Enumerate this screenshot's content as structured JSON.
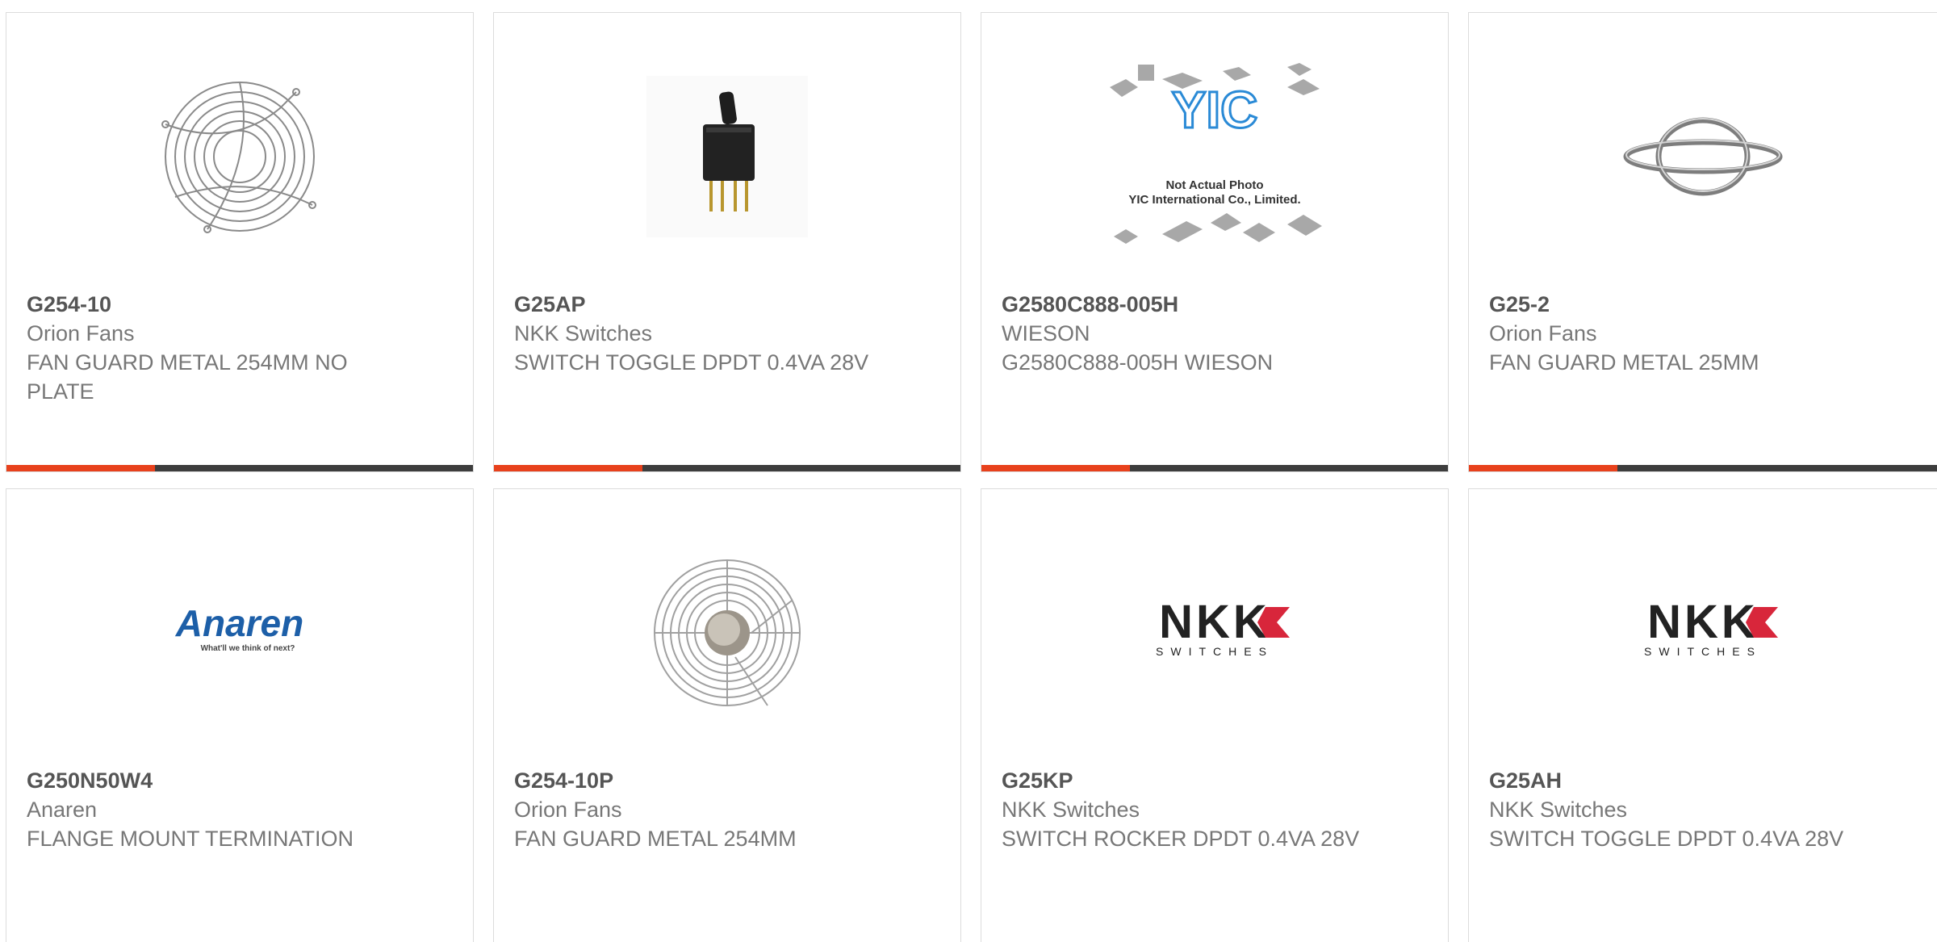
{
  "colors": {
    "accent": "#e8411c",
    "bar": "#3d3d3d",
    "text_title": "#555555",
    "text_body": "#777777",
    "border": "#dcdcdc",
    "nkk_red": "#d8263b",
    "anaren_blue": "#1d5fa8"
  },
  "products": [
    {
      "part": "G254-10",
      "manufacturer": "Orion Fans",
      "description": "FAN GUARD METAL 254MM NO PLATE",
      "image": "fan-guard-spiral-image"
    },
    {
      "part": "G25AP",
      "manufacturer": "NKK Switches",
      "description": "SWITCH TOGGLE DPDT 0.4VA 28V",
      "image": "toggle-switch-image"
    },
    {
      "part": "G2580C888-005H",
      "manufacturer": "WIESON",
      "description": "G2580C888-005H WIESON",
      "image": "yic-placeholder-image",
      "placeholder": {
        "logo": "YIC",
        "line1": "Not Actual Photo",
        "line2": "YIC International Co., Limited."
      }
    },
    {
      "part": "G25-2",
      "manufacturer": "Orion Fans",
      "description": "FAN GUARD METAL 25MM",
      "image": "fan-guard-ring-image"
    },
    {
      "part": "G250N50W4",
      "manufacturer": "Anaren",
      "description": "FLANGE MOUNT TERMINATION",
      "image": "anaren-logo-image",
      "logo": {
        "name": "Anaren",
        "tagline": "What'll we think of next?"
      }
    },
    {
      "part": "G254-10P",
      "manufacturer": "Orion Fans",
      "description": "FAN GUARD METAL 254MM",
      "image": "fan-guard-plate-image"
    },
    {
      "part": "G25KP",
      "manufacturer": "NKK Switches",
      "description": "SWITCH ROCKER DPDT 0.4VA 28V",
      "image": "nkk-logo-image",
      "logo": {
        "name": "NKK",
        "tagline": "SWITCHES"
      }
    },
    {
      "part": "G25AH",
      "manufacturer": "NKK Switches",
      "description": "SWITCH TOGGLE DPDT 0.4VA 28V",
      "image": "nkk-logo-image",
      "logo": {
        "name": "NKK",
        "tagline": "SWITCHES"
      }
    }
  ]
}
